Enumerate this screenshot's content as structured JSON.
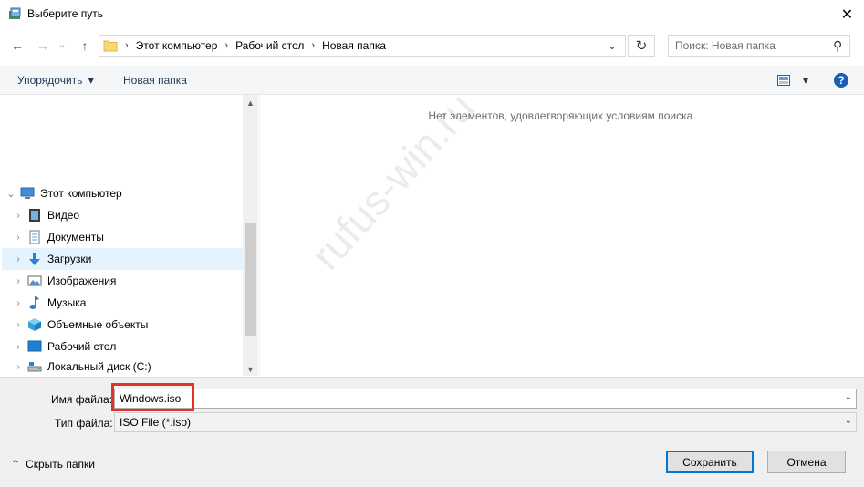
{
  "window": {
    "title": "Выберите путь",
    "close_glyph": "✕"
  },
  "nav": {
    "back_glyph": "←",
    "forward_glyph": "→",
    "recent_glyph": "⌄",
    "up_glyph": "↑",
    "breadcrumb": [
      "Этот компьютер",
      "Рабочий стол",
      "Новая папка"
    ],
    "crumb_sep": "›",
    "dropdown_glyph": "⌄",
    "refresh_glyph": "↻",
    "search_placeholder": "Поиск: Новая папка",
    "search_glyph": "⚲"
  },
  "toolbar": {
    "organize_label": "Упорядочить",
    "organize_caret": "▾",
    "new_folder_label": "Новая папка",
    "view_caret": "▾",
    "help_glyph": "?"
  },
  "tree": {
    "root": {
      "label": "Этот компьютер",
      "icon": "computer-icon"
    },
    "items": [
      {
        "label": "Видео",
        "icon": "video-icon"
      },
      {
        "label": "Документы",
        "icon": "documents-icon"
      },
      {
        "label": "Загрузки",
        "icon": "downloads-icon",
        "selected": true
      },
      {
        "label": "Изображения",
        "icon": "pictures-icon"
      },
      {
        "label": "Музыка",
        "icon": "music-icon"
      },
      {
        "label": "Объемные объекты",
        "icon": "3d-objects-icon"
      },
      {
        "label": "Рабочий стол",
        "icon": "desktop-icon"
      },
      {
        "label": "Локальный диск (C:)",
        "icon": "drive-icon"
      }
    ],
    "expand_glyph": "›",
    "collapse_glyph": "⌄",
    "scroll_up_glyph": "▲",
    "scroll_down_glyph": "▼"
  },
  "content": {
    "empty_message": "Нет элементов, удовлетворяющих условиям поиска.",
    "watermark": "rufus-win.ru"
  },
  "form": {
    "filename_label": "Имя файла:",
    "filename_value": "Windows.iso",
    "filetype_label": "Тип файла:",
    "filetype_value": "ISO File (*.iso)",
    "dd_glyph": "⌄",
    "hide_folders_label": "Скрыть папки",
    "hide_folders_glyph": "⌃",
    "save_label": "Сохранить",
    "cancel_label": "Отмена"
  },
  "colors": {
    "accent": "#0078d7",
    "highlight": "#e8302a",
    "selected_row": "#e5f3ff"
  }
}
